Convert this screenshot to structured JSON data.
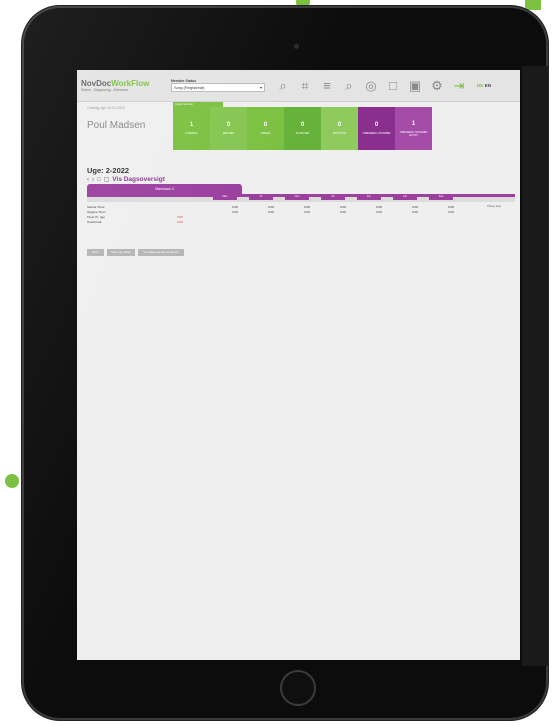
{
  "app": {
    "logo_name": "NovDoc",
    "logo_workflow": "WorkFlow",
    "logo_tagline": "Status - Dagsnavig - Mononne",
    "member_label": "Member Status",
    "member_value": "Sorg (Registreat)",
    "lang_active": "DK",
    "lang_other": "EN"
  },
  "user": {
    "date": "Onsdag uge 19-01-2022",
    "name": "Poul Madsen"
  },
  "status_panel": {
    "label": "Open Gehoor",
    "tiles": [
      {
        "count": "1",
        "label": "OVERBLIK",
        "color": "#7cc142"
      },
      {
        "count": "0",
        "label": "BESTIBE",
        "color": "#86c653"
      },
      {
        "count": "0",
        "label": "ARBEID",
        "color": "#7cc142"
      },
      {
        "count": "0",
        "label": "AFVENTER",
        "color": "#66b23a"
      },
      {
        "count": "0",
        "label": "BOSTTIKE",
        "color": "#8fca5c"
      },
      {
        "count": "0",
        "label": "TIMESEDDL STANDBN",
        "color": "#8b2f8f"
      },
      {
        "count": "1",
        "label": "TIMESEDDL STANDBN AFVIST",
        "color": "#a44ca8"
      }
    ]
  },
  "week": {
    "title": "Uge: 2-2022",
    "view_title": "Vis Dagsoversigt",
    "tab_label": "Maerkaan 3"
  },
  "days": [
    "Man",
    "Tir",
    "Ons",
    "Tor",
    "Fre",
    "Lør",
    "Søn"
  ],
  "rows": [
    {
      "label": "Samlet Timer",
      "cells": [
        "0:00",
        "0:00",
        "0:00",
        "0:00",
        "0:00",
        "0:00",
        "0:00"
      ]
    },
    {
      "label": "Opgave Timer",
      "cells": [
        "0:00",
        "0:00",
        "0:00",
        "0:00",
        "0:00",
        "0:00",
        "0:00"
      ]
    },
    {
      "label": "Timer Pr. uge",
      "value": "0:00"
    },
    {
      "label": "Overtid ialt",
      "value": "0:00"
    }
  ],
  "scroll_tip": "Tilfoej linje",
  "buttons": [
    "Gem",
    "Gem og afslut",
    "Vis dagsoversigt og lanceri"
  ]
}
